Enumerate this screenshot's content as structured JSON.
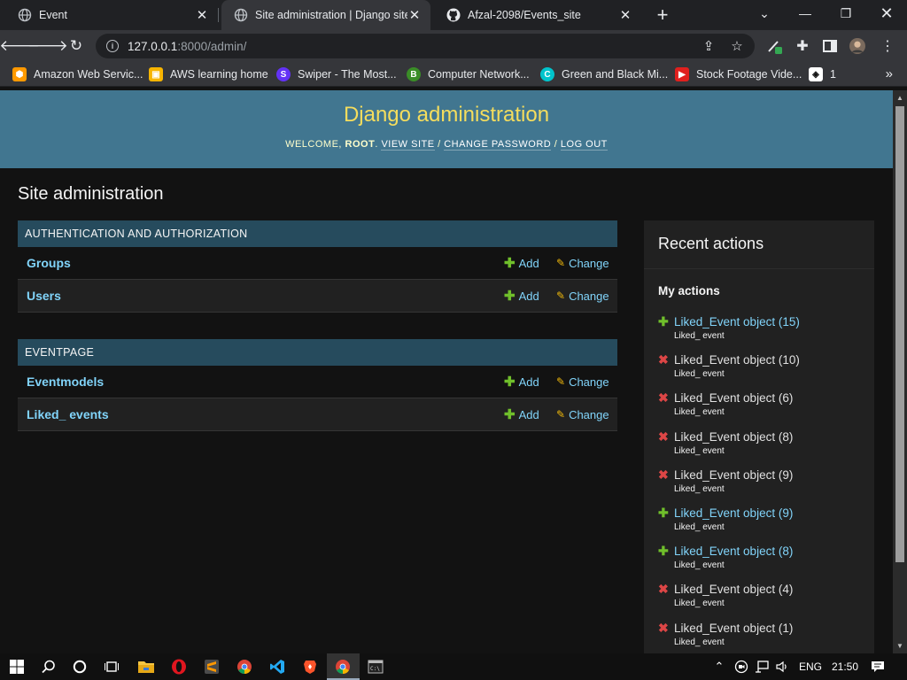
{
  "browser": {
    "tabs": [
      {
        "title": "Event",
        "active": false
      },
      {
        "title": "Site administration | Django site a",
        "active": true
      },
      {
        "title": "Afzal-2098/Events_site",
        "active": false
      }
    ],
    "url_host": "127.0.0.1",
    "url_rest": ":8000/admin/",
    "bookmarks": [
      {
        "label": "Amazon Web Servic...",
        "icon": "aws-cube-icon",
        "color": "#f90"
      },
      {
        "label": "AWS learning home",
        "icon": "box-icon",
        "color": "#f7b500"
      },
      {
        "label": "Swiper - The Most...",
        "icon": "swiper-icon",
        "color": "#6332f6"
      },
      {
        "label": "Computer Network...",
        "icon": "bootstrap-icon",
        "color": "#3a8d27"
      },
      {
        "label": "Green and Black Mi...",
        "icon": "canva-icon",
        "color": "#00c4cc"
      },
      {
        "label": "Stock Footage Vide...",
        "icon": "storyblocks-icon",
        "color": "#e0201e"
      },
      {
        "label": "1",
        "icon": "codepen-icon",
        "color": "#ffffff"
      }
    ]
  },
  "header": {
    "brand": "Django administration",
    "welcome": "Welcome, ",
    "user": "root",
    "view_site": "View site",
    "change_password": "Change password",
    "log_out": "Log out",
    "sep": " / "
  },
  "page_title": "Site administration",
  "modules": [
    {
      "caption": "AUTHENTICATION AND AUTHORIZATION",
      "rows": [
        {
          "name": "Groups",
          "add": "Add",
          "change": "Change"
        },
        {
          "name": "Users",
          "add": "Add",
          "change": "Change"
        }
      ]
    },
    {
      "caption": "EVENTPAGE",
      "rows": [
        {
          "name": "Eventmodels",
          "add": "Add",
          "change": "Change"
        },
        {
          "name": "Liked_ events",
          "add": "Add",
          "change": "Change"
        }
      ]
    }
  ],
  "recent": {
    "title": "Recent actions",
    "subtitle": "My actions",
    "actions": [
      {
        "text": "Liked_Event object (15)",
        "type": "Liked_ event",
        "kind": "add"
      },
      {
        "text": "Liked_Event object (10)",
        "type": "Liked_ event",
        "kind": "del"
      },
      {
        "text": "Liked_Event object (6)",
        "type": "Liked_ event",
        "kind": "del"
      },
      {
        "text": "Liked_Event object (8)",
        "type": "Liked_ event",
        "kind": "del"
      },
      {
        "text": "Liked_Event object (9)",
        "type": "Liked_ event",
        "kind": "del"
      },
      {
        "text": "Liked_Event object (9)",
        "type": "Liked_ event",
        "kind": "add"
      },
      {
        "text": "Liked_Event object (8)",
        "type": "Liked_ event",
        "kind": "add"
      },
      {
        "text": "Liked_Event object (4)",
        "type": "Liked_ event",
        "kind": "del"
      },
      {
        "text": "Liked_Event object (1)",
        "type": "Liked_ event",
        "kind": "del"
      }
    ]
  },
  "taskbar": {
    "language": "ENG",
    "time": "21:50"
  },
  "colors": {
    "header_bg": "#417690",
    "brand": "#f5dd5d",
    "caption_bg": "#264b5d",
    "link": "#81d4fa",
    "add_green": "#70bf2b",
    "delete_red": "#dd4646",
    "change_yellow": "#efb80b"
  }
}
